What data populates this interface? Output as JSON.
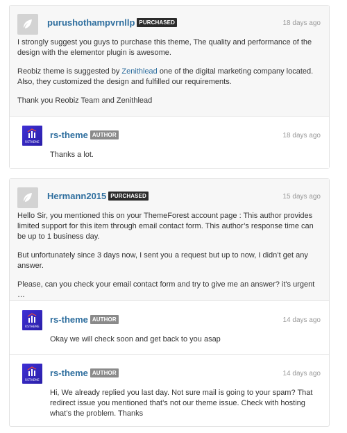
{
  "threads": [
    {
      "comment": {
        "username": "purushothampvrnllp",
        "badge": "PURCHASED",
        "timestamp": "18 days ago",
        "p1": "I strongly suggest you guys to purchase this theme, The quality and performance of the design with the elementor plugin is awesome.",
        "p2_before": "Reobiz theme is suggested by ",
        "p2_link": "Zenithlead",
        "p2_after": " one of the digital marketing company located. Also, they customized the design and fulfilled our requirements.",
        "p3": "Thank you Reobiz Team and Zenithlead"
      },
      "replies": [
        {
          "username": "rs-theme",
          "badge": "AUTHOR",
          "timestamp": "18 days ago",
          "text": "Thanks a lot."
        }
      ]
    },
    {
      "comment": {
        "username": "Hermann2015",
        "badge": "PURCHASED",
        "timestamp": "15 days ago",
        "p1": "Hello Sir, you mentioned this on your ThemeForest account page : This author provides limited support for this item through email contact form. This author’s response time can be up to 1 business day.",
        "p2": "But unfortunately since 3 days now, I sent you a request but up to now, I didn’t get any answer.",
        "p3": "Please, can you check your email contact form and try to give me an answer? it's urgent …"
      },
      "replies": [
        {
          "username": "rs-theme",
          "badge": "AUTHOR",
          "timestamp": "14 days ago",
          "text": "Okay we will check soon and get back to you asap"
        },
        {
          "username": "rs-theme",
          "badge": "AUTHOR",
          "timestamp": "14 days ago",
          "text": "Hi, We already replied you last day. Not sure mail is going to your spam? That redirect issue you mentioned that’s not our theme issue. Check with hosting what’s the problem. Thanks"
        }
      ]
    }
  ],
  "author_avatar_text": "RSTHEME",
  "icons": {
    "default_avatar": "envato-leaf-icon",
    "author_avatar": "rstheme-logo-icon"
  },
  "colors": {
    "username": "#2e6e9e",
    "purchased_badge": "#2b2b2b",
    "author_badge": "#8a8a8a",
    "author_avatar_bg": "#3f2fd4",
    "comment_bg": "#f7f7f7"
  }
}
